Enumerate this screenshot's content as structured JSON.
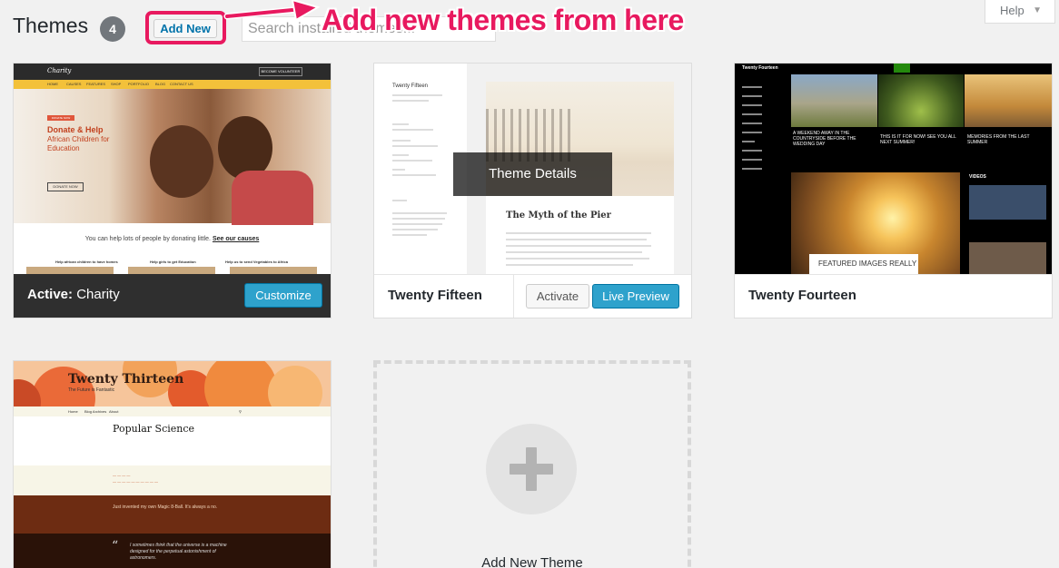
{
  "header": {
    "title": "Themes",
    "count": "4",
    "add_new_label": "Add New",
    "search_placeholder": "Search installed themes...",
    "help_label": "Help",
    "annotation": "Add new themes from here",
    "annotation_color": "#e8195f"
  },
  "themes": [
    {
      "id": "charity",
      "active_prefix": "Active:",
      "name": "Charity",
      "button_label": "Customize",
      "preview": {
        "logo": "Charity",
        "volunteer_label": "BECOME VOLUNTEER",
        "nav": [
          "HOME",
          "CAUSES",
          "FEATURES",
          "SHOP",
          "PORTFOLIO",
          "BLOG",
          "CONTACT US"
        ],
        "badge": "DONATE NOW",
        "hero_title": "Donate & Help",
        "hero_subtitle": "African Children for Education",
        "donate_button": "DONATE NOW",
        "tagline": "You can help lots of people by donating little.",
        "tagline_link": "See our causes",
        "causes": [
          "Help african children to have homes",
          "Help girls to get Education",
          "Help us to send Vegetables to Africa"
        ]
      }
    },
    {
      "id": "twenty-fifteen",
      "name": "Twenty Fifteen",
      "overlay_label": "Theme Details",
      "activate_label": "Activate",
      "preview_label": "Live Preview",
      "preview": {
        "site_title": "Twenty Fifteen",
        "post_title": "The Myth of the Pier"
      }
    },
    {
      "id": "twenty-fourteen",
      "name": "Twenty Fourteen",
      "preview": {
        "site_title": "Twenty Fourteen",
        "captions": [
          "A WEEKEND AWAY IN THE COUNTRYSIDE BEFORE THE WEDDING DAY",
          "THIS IS IT FOR NOW! SEE YOU ALL NEXT SUMMER!",
          "MEMORIES FROM THE LAST SUMMER"
        ],
        "featured_label": "FEATURED IMAGES REALLY",
        "videos_label": "VIDEOS"
      }
    },
    {
      "id": "twenty-thirteen",
      "name": "Twenty Thirteen",
      "preview": {
        "site_title": "Twenty Thirteen",
        "tagline": "The Future is Fantastic",
        "nav": [
          "Home",
          "Blog Archives",
          "About"
        ],
        "post_title": "Popular Science",
        "quote": "I sometimes think that the universe is a machine designed for the perpetual astonishment of astronomers.",
        "band_line": "Just invented my own Magic 8-Ball. It's always a no."
      }
    }
  ],
  "add_new_theme_label": "Add New Theme"
}
